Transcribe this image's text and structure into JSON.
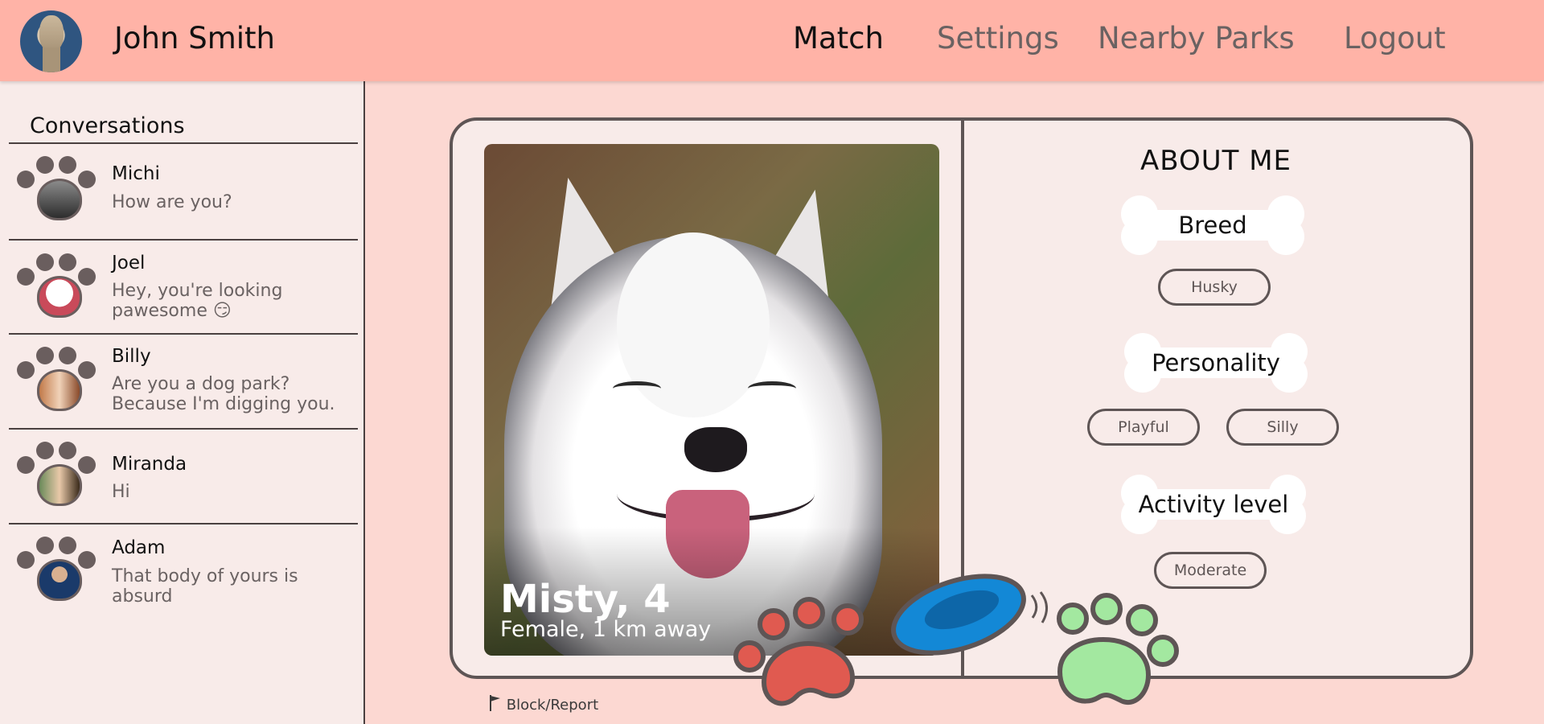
{
  "header": {
    "user_name": "John Smith",
    "nav": [
      {
        "label": "Match",
        "active": true
      },
      {
        "label": "Settings",
        "active": false
      },
      {
        "label": "Nearby Parks",
        "active": false
      },
      {
        "label": "Logout",
        "active": false
      }
    ]
  },
  "sidebar": {
    "title": "Conversations",
    "conversations": [
      {
        "name": "Michi",
        "message": "How are you?"
      },
      {
        "name": "Joel",
        "message": "Hey, you're looking pawesome 😏"
      },
      {
        "name": "Billy",
        "message": "Are you a dog park? Because I'm digging you."
      },
      {
        "name": "Miranda",
        "message": "Hi"
      },
      {
        "name": "Adam",
        "message": "That body of yours is absurd"
      }
    ]
  },
  "profile": {
    "title": "Misty, 4",
    "subtitle": "Female, 1 km away",
    "about_title": "ABOUT ME",
    "breed_label": "Breed",
    "breed": "Husky",
    "personality_label": "Personality",
    "personality": [
      "Playful",
      "Silly"
    ],
    "activity_label": "Activity level",
    "activity": "Moderate"
  },
  "actions": {
    "report_label": "Block/Report"
  },
  "colors": {
    "header_bg": "#ffb3a7",
    "page_bg": "#fcd8d2",
    "panel_bg": "#f8ebe9",
    "outline": "#5e5555",
    "reject_paw": "#e05a50",
    "like_paw": "#a3e8a0",
    "frisbee": "#1388d6"
  },
  "icons": {
    "reject": "red-paw-icon",
    "like": "green-paw-icon",
    "frisbee": "frisbee-icon",
    "report": "flag-icon"
  }
}
